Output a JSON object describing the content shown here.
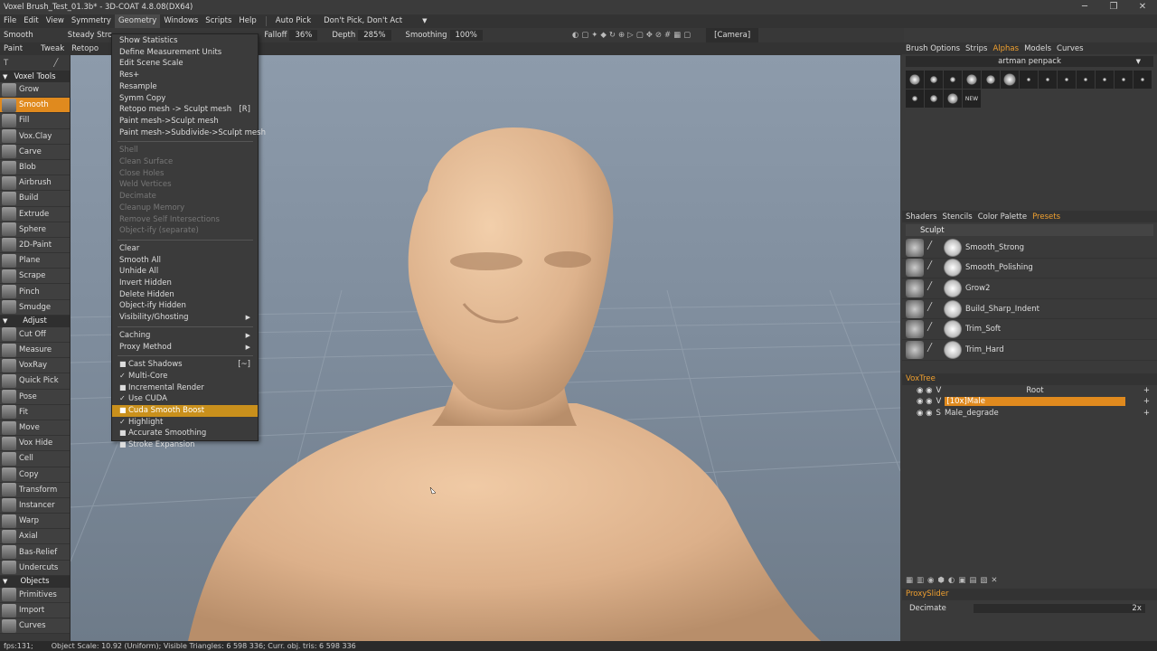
{
  "window": {
    "title": "Voxel Brush_Test_01.3b* - 3D-COAT 4.8.08(DX64)"
  },
  "menubar": {
    "items": [
      "File",
      "Edit",
      "View",
      "Symmetry",
      "Geometry",
      "Windows",
      "Scripts",
      "Help"
    ],
    "autopick": "Auto Pick",
    "pick_mode": "Don't Pick, Don't Act"
  },
  "toolbar": {
    "tool": "Smooth",
    "steady": "Steady Stro",
    "falloff_label": "Falloff",
    "falloff": "36%",
    "depth_label": "Depth",
    "depth": "285%",
    "smoothing_label": "Smoothing",
    "smoothing": "100%",
    "camera": "[Camera]"
  },
  "subtabs": [
    "Paint",
    "Tweak",
    "Retopo"
  ],
  "leftpanel": {
    "voxel_tools_title": "Voxel  Tools",
    "voxel_tools": [
      "Grow",
      "Smooth",
      "Fill",
      "Vox.Clay",
      "Carve",
      "Blob",
      "Airbrush",
      "Build",
      "Extrude",
      "Sphere",
      "2D-Paint",
      "Plane",
      "Scrape",
      "Pinch",
      "Smudge"
    ],
    "adjust_title": "Adjust",
    "adjust_tools": [
      "Cut Off",
      "Measure",
      "VoxRay",
      "Quick Pick",
      "Pose",
      "Fit",
      "Move",
      "Vox Hide",
      "Cell",
      "Copy",
      "Transform",
      "Instancer",
      "Warp",
      "Axial",
      "Bas-Relief",
      "Undercuts"
    ],
    "objects_title": "Objects",
    "object_tools": [
      "Primitives",
      "Import",
      "Curves"
    ]
  },
  "geometry_menu": {
    "group1": [
      "Show Statistics",
      "Define Measurement Units",
      "Edit Scene Scale",
      "Res+",
      "Resample",
      "Symm Copy"
    ],
    "retopo": {
      "label": "Retopo  mesh -> Sculpt mesh",
      "shortcut": "[R]"
    },
    "group1b": [
      "Paint mesh->Sculpt mesh",
      "Paint mesh->Subdivide->Sculpt mesh"
    ],
    "disabled": [
      "Shell",
      "Clean Surface",
      "Close Holes",
      "Weld Vertices",
      "Decimate",
      "Cleanup Memory",
      "Remove Self Intersections",
      "Object-ify (separate)"
    ],
    "group2": [
      "Clear",
      "Smooth  All",
      "Unhide  All",
      "Invert Hidden",
      "Delete Hidden",
      "Object-ify Hidden"
    ],
    "visibility": "Visibility/Ghosting",
    "caching": "Caching",
    "proxy": "Proxy Method",
    "cast_shadows": {
      "label": "Cast Shadows",
      "shortcut": "[~]"
    },
    "checks": [
      {
        "label": "Multi-Core",
        "checked": true
      },
      {
        "label": "Incremental Render",
        "checked": false
      },
      {
        "label": "Use CUDA",
        "checked": true
      },
      {
        "label": "Cuda Smooth Boost",
        "checked": false,
        "highlight": true
      },
      {
        "label": "Highlight",
        "checked": true
      },
      {
        "label": "Accurate Smoothing",
        "checked": false
      },
      {
        "label": "Stroke Expansion",
        "checked": false
      }
    ]
  },
  "rightpanel": {
    "tabs1": [
      "Brush Options",
      "Strips",
      "Alphas",
      "Models",
      "Curves"
    ],
    "active_tab1": "Alphas",
    "pack": "artman penpack",
    "new_label": "NEW",
    "tabs2": [
      "Shaders",
      "Stencils",
      "Color Palette",
      "Presets"
    ],
    "active_tab2": "Presets",
    "preset_group": "Sculpt",
    "presets": [
      "Smooth_Strong",
      "Smooth_Polishing",
      "Grow2",
      "Build_Sharp_Indent",
      "Trim_Soft",
      "Trim_Hard"
    ],
    "voxtree_title": "VoxTree",
    "voxtree": [
      {
        "name": "Root",
        "flag": "V"
      },
      {
        "name": "[10x]Male",
        "flag": "V",
        "selected": true
      },
      {
        "name": "Male_degrade",
        "flag": "S"
      }
    ],
    "proxy_title": "ProxySlider",
    "decimate": "Decimate",
    "decimate_val": "2x"
  },
  "statusbar": {
    "fps": "fps:131;",
    "info": "Object Scale: 10.92 (Uniform); Visible Triangles: 6 598 336; Curr. obj. tris: 6 598 336"
  },
  "colors": {
    "accent": "#e08a1e",
    "highlight": "#c9901c",
    "skin": "#e2b894",
    "viewport": "#7f8d9d"
  }
}
